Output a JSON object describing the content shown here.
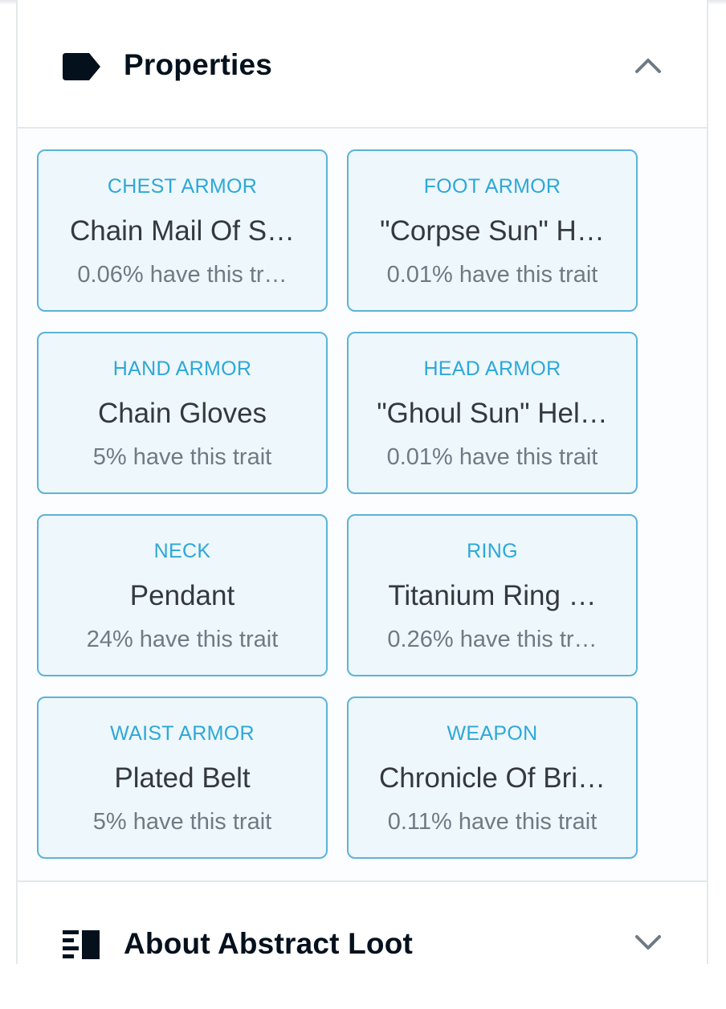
{
  "properties_section": {
    "title": "Properties",
    "icon": "tag-icon",
    "toggle_icon": "chevron-up-icon"
  },
  "traits": [
    {
      "trait_type": "CHEST ARMOR",
      "value": "Chain Mail Of S…",
      "rarity": "0.06% have this tr…"
    },
    {
      "trait_type": "FOOT ARMOR",
      "value": "\"Corpse Sun\" H…",
      "rarity": "0.01% have this trait"
    },
    {
      "trait_type": "HAND ARMOR",
      "value": "Chain Gloves",
      "rarity": "5% have this trait"
    },
    {
      "trait_type": "HEAD ARMOR",
      "value": "\"Ghoul Sun\" Hel…",
      "rarity": "0.01% have this trait"
    },
    {
      "trait_type": "NECK",
      "value": "Pendant",
      "rarity": "24% have this trait"
    },
    {
      "trait_type": "RING",
      "value": "Titanium Ring …",
      "rarity": "0.26% have this tr…"
    },
    {
      "trait_type": "WAIST ARMOR",
      "value": "Plated Belt",
      "rarity": "5% have this trait"
    },
    {
      "trait_type": "WEAPON",
      "value": "Chronicle Of Bri…",
      "rarity": "0.11% have this trait"
    }
  ],
  "about_section": {
    "title": "About Abstract Loot",
    "icon": "description-list-icon",
    "toggle_icon": "chevron-down-icon"
  },
  "colors": {
    "card_background": "#eef7fc",
    "card_border": "#5cb3d8",
    "trait_type_text": "#2da8d8",
    "value_text": "#353840",
    "rarity_text": "#707a83",
    "header_text": "#04111d"
  }
}
